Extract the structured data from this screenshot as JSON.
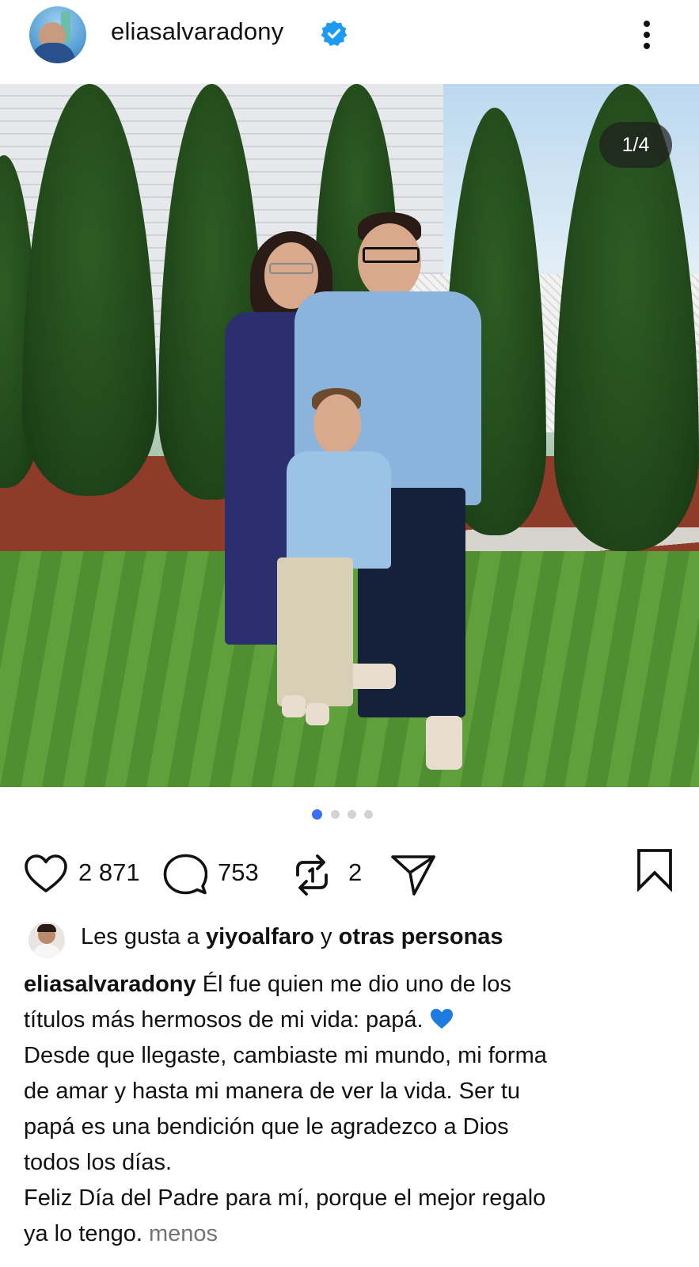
{
  "header": {
    "username": "eliasalvaradony",
    "verified": true,
    "icons": {
      "avatar": "profile-avatar",
      "verified": "verified-badge-icon",
      "more": "more-vertical-icon"
    }
  },
  "post": {
    "page_counter": "1/4",
    "carousel": {
      "total": 4,
      "active_index": 0
    },
    "accent_color": "#3b6ef0"
  },
  "actions": {
    "likes_count": "2 871",
    "comments_count": "753",
    "reposts_count": "2",
    "icons": [
      "heart-icon",
      "comment-icon",
      "repost-icon",
      "share-icon",
      "bookmark-icon"
    ]
  },
  "likes": {
    "prefix": "Les gusta a ",
    "user": "yiyoalfaro",
    "middle": " y ",
    "others": "otras personas"
  },
  "caption": {
    "username": "eliasalvaradony",
    "line1": " Él fue quien me dio uno de los",
    "line2": "títulos más hermosos de mi vida: papá. ",
    "line3": "Desde que llegaste, cambiaste mi mundo, mi forma",
    "line4": "de amar y hasta mi manera de ver la vida. Ser tu",
    "line5": "papá es una bendición que le agradezco a Dios",
    "line6": "todos los días.",
    "line7": "Feliz Día del Padre para mí, porque el mejor regalo",
    "line8": "ya lo tengo. ",
    "less": "menos"
  }
}
